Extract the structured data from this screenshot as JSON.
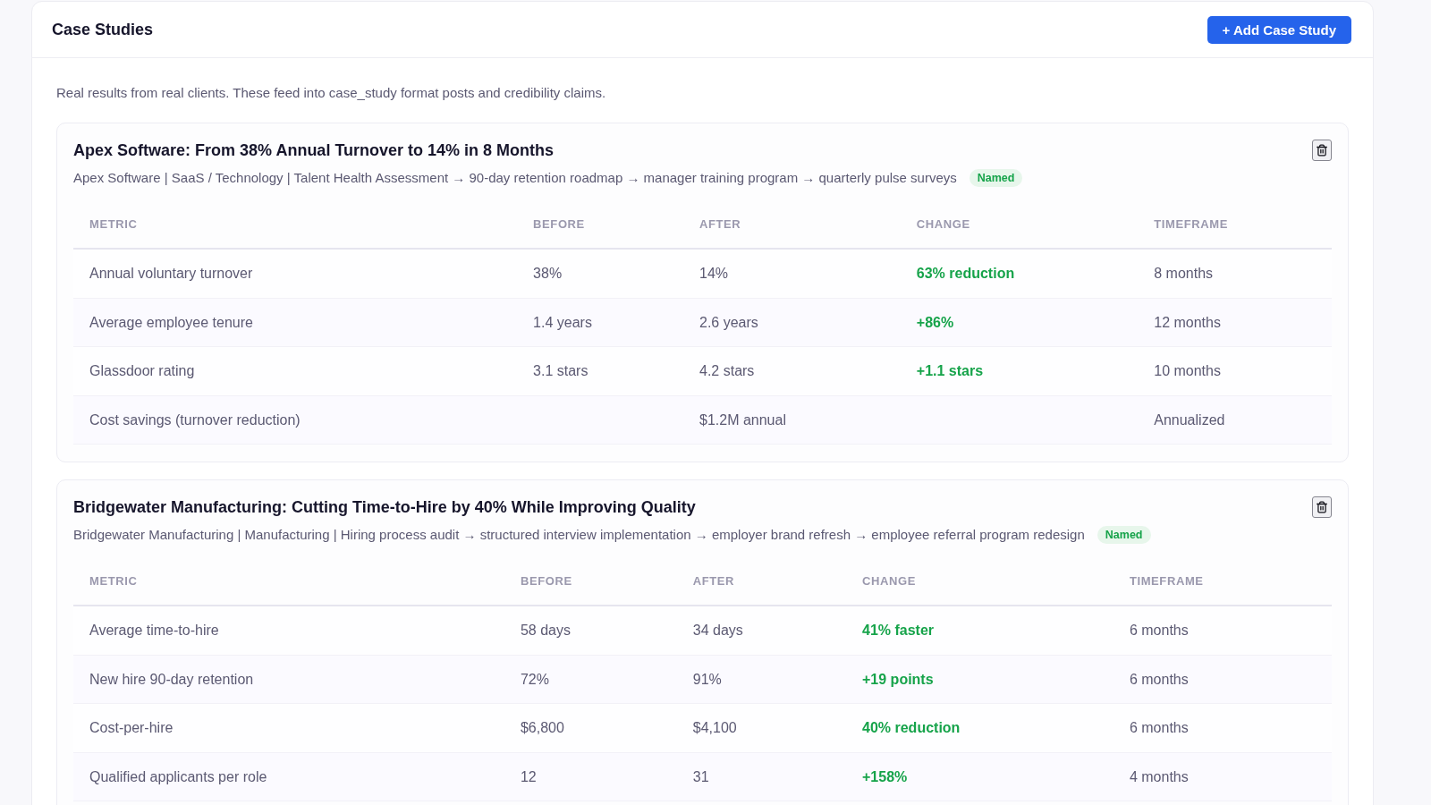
{
  "header": {
    "title": "Case Studies",
    "add_button": "+ Add Case Study"
  },
  "description": "Real results from real clients. These feed into case_study format posts and credibility claims.",
  "case_studies": [
    {
      "title": "Apex Software: From 38% Annual Turnover to 14% in 8 Months",
      "meta": "Apex Software | SaaS / Technology | Talent Health Assessment → 90-day retention roadmap → manager training program → quarterly pulse surveys",
      "tag": "Named",
      "columns": [
        "METRIC",
        "BEFORE",
        "AFTER",
        "CHANGE",
        "TIMEFRAME"
      ],
      "rows": [
        {
          "metric": "Annual voluntary turnover",
          "before": "38%",
          "after": "14%",
          "change": "63% reduction",
          "timeframe": "8 months"
        },
        {
          "metric": "Average employee tenure",
          "before": "1.4 years",
          "after": "2.6 years",
          "change": "+86%",
          "timeframe": "12 months"
        },
        {
          "metric": "Glassdoor rating",
          "before": "3.1 stars",
          "after": "4.2 stars",
          "change": "+1.1 stars",
          "timeframe": "10 months"
        },
        {
          "metric": "Cost savings (turnover reduction)",
          "after": "$1.2M annual",
          "timeframe": "Annualized"
        }
      ]
    },
    {
      "title": "Bridgewater Manufacturing: Cutting Time-to-Hire by 40% While Improving Quality",
      "meta": "Bridgewater Manufacturing | Manufacturing | Hiring process audit → structured interview implementation → employer brand refresh → employee referral program redesign",
      "tag": "Named",
      "columns": [
        "METRIC",
        "BEFORE",
        "AFTER",
        "CHANGE",
        "TIMEFRAME"
      ],
      "rows": [
        {
          "metric": "Average time-to-hire",
          "before": "58 days",
          "after": "34 days",
          "change": "41% faster",
          "timeframe": "6 months"
        },
        {
          "metric": "New hire 90-day retention",
          "before": "72%",
          "after": "91%",
          "change": "+19 points",
          "timeframe": "6 months"
        },
        {
          "metric": "Cost-per-hire",
          "before": "$6,800",
          "after": "$4,100",
          "change": "40% reduction",
          "timeframe": "6 months"
        },
        {
          "metric": "Qualified applicants per role",
          "before": "12",
          "after": "31",
          "change": "+158%",
          "timeframe": "4 months"
        }
      ]
    }
  ]
}
